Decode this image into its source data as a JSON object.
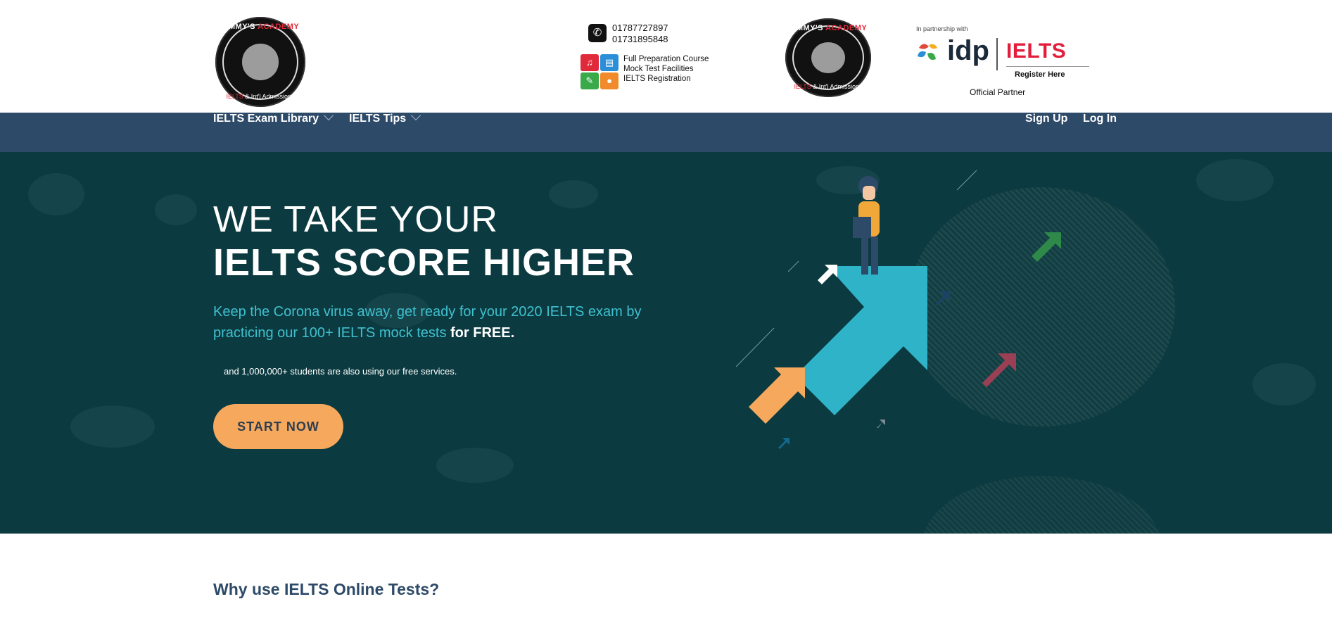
{
  "header": {
    "logo_main": {
      "text_top": "JIMMY'S",
      "text_top_red": "ACADEMY",
      "text_bottom_red": "IELTS",
      "text_bottom": "& Int'l Admissions"
    },
    "contact": {
      "phones": [
        "01787727897",
        "01731895848"
      ],
      "features": [
        "Full Preparation Course",
        "Mock Test Facilities",
        "IELTS Registration"
      ],
      "icons": [
        "headphones-icon",
        "book-icon",
        "pencil-icon",
        "microphone-icon"
      ]
    },
    "logo_small": {
      "text_top": "JIMMY'S",
      "text_top_red": "ACADEMY",
      "text_bottom_red": "IELTS",
      "text_bottom": "& Int'l Admissions"
    },
    "partner": {
      "in_partnership": "In partnership with",
      "idp": "idp",
      "ielts": "IELTS",
      "register": "Register Here",
      "official": "Official Partner"
    }
  },
  "nav": {
    "left": [
      {
        "label": "IELTS Exam Library"
      },
      {
        "label": "IELTS Tips"
      }
    ],
    "right": [
      {
        "label": "Sign Up"
      },
      {
        "label": "Log In"
      }
    ]
  },
  "hero": {
    "title_line1": "WE TAKE YOUR",
    "title_line2": "IELTS SCORE HIGHER",
    "lead": "Keep the Corona virus away, get ready for your 2020 IELTS exam by practicing our 100+ IELTS mock tests",
    "lead_bold": "for FREE.",
    "small": "and 1,000,000+ students are also using our free services.",
    "cta": "START NOW"
  },
  "section": {
    "why_title": "Why use IELTS Online Tests?"
  },
  "colors": {
    "nav_bg": "#2d4a68",
    "hero_bg": "#0b3a40",
    "accent_teal": "#3fc1cf",
    "cta_orange": "#f6a85c",
    "ielts_red": "#e31d3c"
  }
}
